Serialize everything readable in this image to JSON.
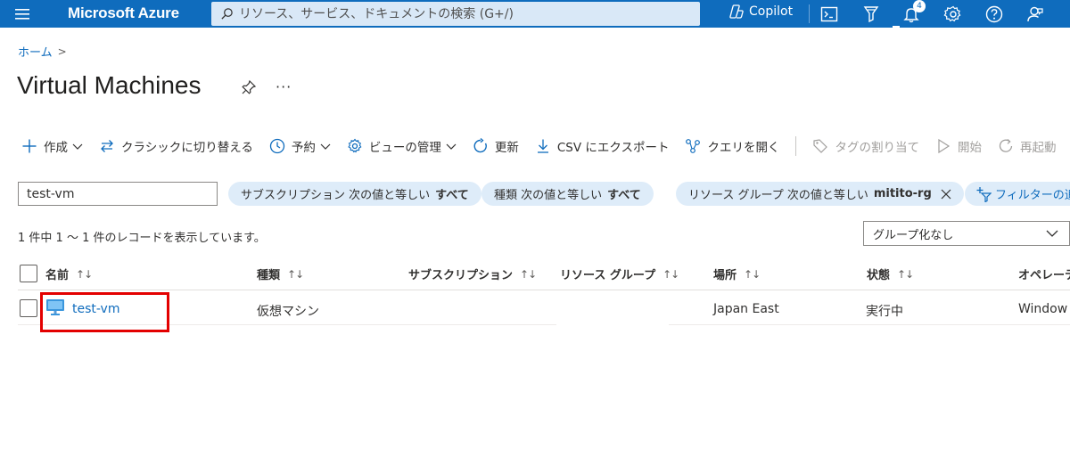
{
  "topbar": {
    "brand": "Microsoft Azure",
    "search_placeholder": "リソース、サービス、ドキュメントの検索 (G+/)",
    "copilot_label": "Copilot",
    "notification_count": "4"
  },
  "breadcrumb": {
    "home": "ホーム",
    "separator": ">"
  },
  "page": {
    "title": "Virtual Machines",
    "more": "···"
  },
  "commands": {
    "create": "作成",
    "switch_classic": "クラシックに切り替える",
    "reserve": "予約",
    "manage_view": "ビューの管理",
    "refresh": "更新",
    "export_csv": "CSV にエクスポート",
    "open_query": "クエリを開く",
    "assign_tags": "タグの割り当て",
    "start": "開始",
    "restart": "再起動"
  },
  "filters": {
    "search_value": "test-vm",
    "subscription": {
      "label": "サブスクリプション 次の値と等しい",
      "value": "すべて"
    },
    "type": {
      "label": "種類 次の値と等しい",
      "value": "すべて"
    },
    "resource_group": {
      "label": "リソース グループ 次の値と等しい",
      "value": "mitito-rg"
    },
    "add_filter": "フィルターの追加"
  },
  "record_count": "1 件中 1 ～ 1 件のレコードを表示しています。",
  "grouping": {
    "selected": "グループ化なし"
  },
  "table": {
    "columns": {
      "name": "名前",
      "type": "種類",
      "subscription": "サブスクリプション",
      "resource_group": "リソース グループ",
      "location": "場所",
      "status": "状態",
      "os": "オペレーティ"
    },
    "sort_glyph": "↑↓",
    "rows": [
      {
        "name": "test-vm",
        "type": "仮想マシン",
        "subscription": "",
        "resource_group": "",
        "location": "Japan East",
        "status": "実行中",
        "os": "Window"
      }
    ]
  },
  "colors": {
    "brand_blue": "#0f6cbd",
    "highlight_red": "#e30000",
    "pill_bg": "#deecf9"
  }
}
